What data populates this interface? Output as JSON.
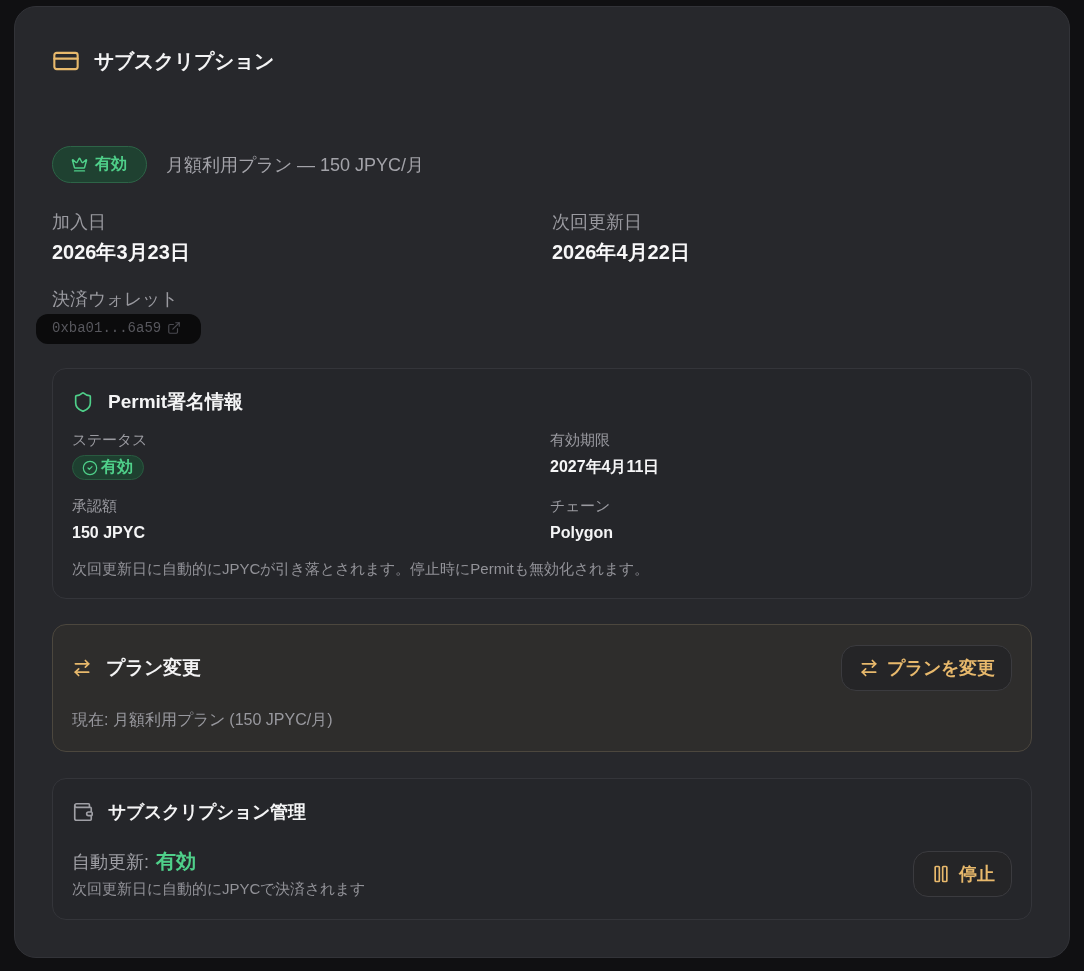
{
  "header": {
    "title": "サブスクリプション"
  },
  "plan": {
    "status": {
      "label": "有効",
      "active": true
    },
    "description": "月額利用プラン — 150 JPYC/月"
  },
  "details": [
    {
      "label": "加入日",
      "value": "2026年3月23日"
    },
    {
      "label": "次回更新日",
      "value": "2026年4月22日"
    }
  ],
  "wallet": {
    "label": "決済ウォレット",
    "address": "0xba01...6a59",
    "redacted": true
  },
  "permit": {
    "title": "Permit署名情報",
    "fields": [
      {
        "label": "ステータス",
        "kind": "badge",
        "value": "有効",
        "valid": true
      },
      {
        "label": "有効期限",
        "kind": "text",
        "value": "2027年4月11日"
      },
      {
        "label": "承認額",
        "kind": "text",
        "value": "150 JPYC"
      },
      {
        "label": "チェーン",
        "kind": "text",
        "value": "Polygon"
      }
    ],
    "note": "次回更新日に自動的にJPYCが引き落とされます。停止時にPermitも無効化されます。"
  },
  "plan_change": {
    "title": "プラン変更",
    "button": "プランを変更",
    "current": "現在: 月額利用プラン (150 JPYC/月)"
  },
  "management": {
    "title": "サブスクリプション管理",
    "auto_renew_label": "自動更新:",
    "auto_renew_value": "有効",
    "auto_renew_on": true,
    "note": "次回更新日に自動的にJPYCで決済されます",
    "button": "停止"
  }
}
